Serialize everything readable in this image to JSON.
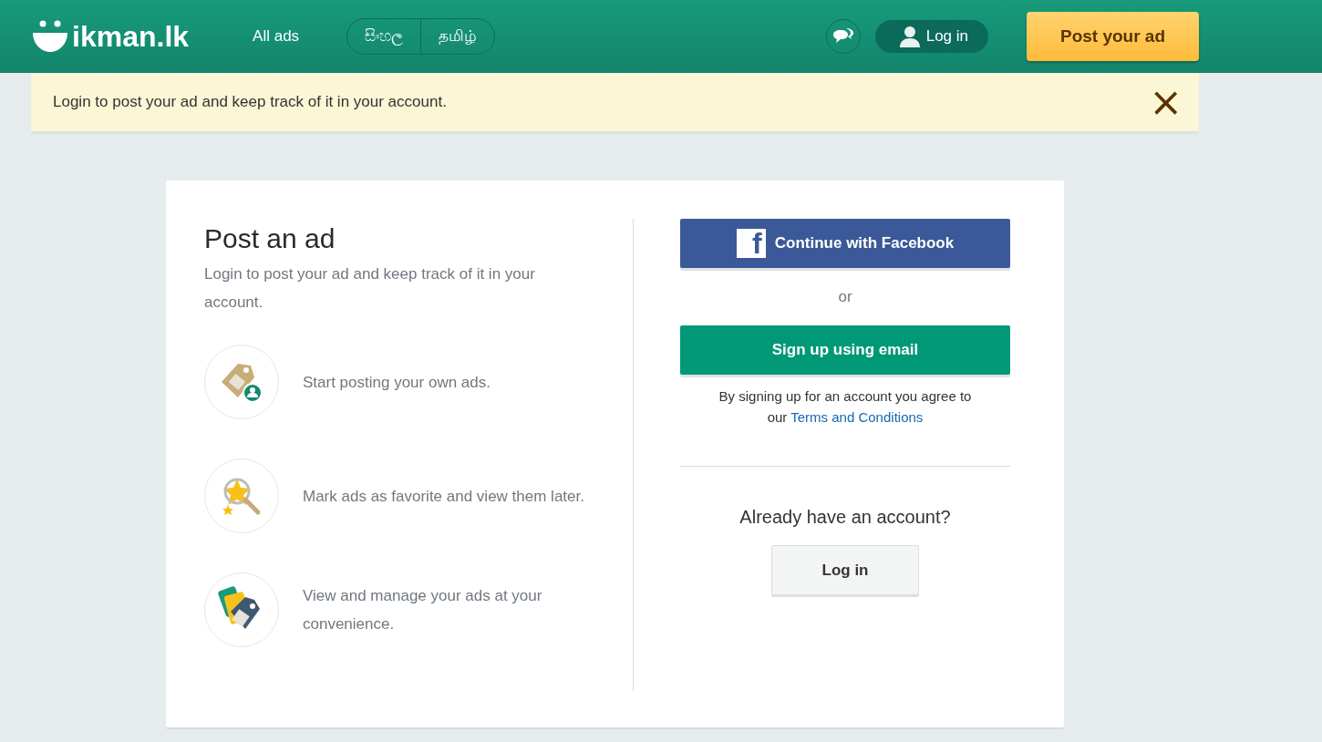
{
  "header": {
    "logo": "ikman.lk",
    "nav_link": "All ads",
    "languages": [
      "සිංහල",
      "தமிழ்"
    ],
    "login": "Log in",
    "post_button": "Post your ad"
  },
  "notice": {
    "text": "Login to post your ad and keep track of it in your account.",
    "close": "×"
  },
  "card": {
    "title": "Post an ad",
    "subtitle": "Login to post your ad and keep track of it in your account.",
    "features": [
      {
        "kind": "tag-user",
        "text": "Start posting your own ads."
      },
      {
        "kind": "star-search",
        "text": "Mark ads as favorite and view them later."
      },
      {
        "kind": "tags",
        "text": "View and manage your ads at your convenience."
      }
    ],
    "facebook_button": "Continue with Facebook",
    "facebook_glyph": "f",
    "or": "or",
    "email_button": "Sign up using email",
    "terms_text": "By signing up for an account you agree to our",
    "terms_link": "Terms and Conditions",
    "already": "Already have an account?",
    "login_button": "Log in"
  }
}
